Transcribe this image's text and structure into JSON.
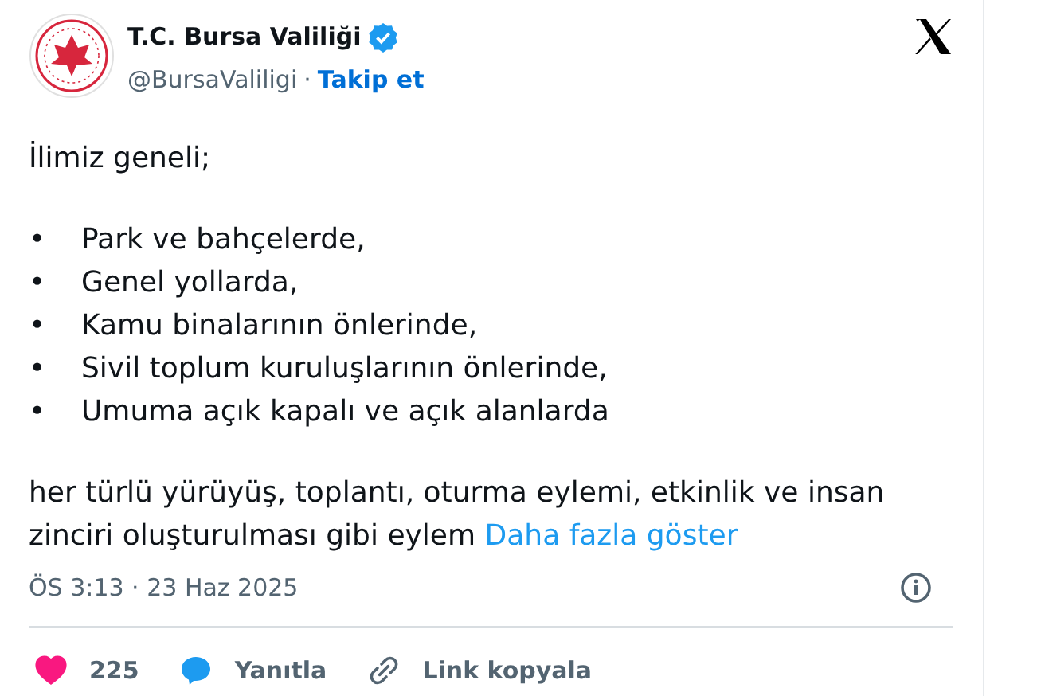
{
  "account": {
    "name": "T.C. Bursa Valiliği",
    "verified": true,
    "handle": "@BursaValiligi",
    "separator": "·",
    "follow": "Takip et"
  },
  "post": {
    "intro": "İlimiz geneli;",
    "bullets": [
      "Park ve bahçelerde,",
      "Genel yollarda,",
      "Kamu binalarının önlerinde,",
      "Sivil toplum kuruluşlarının önlerinde,",
      "Umuma açık kapalı ve açık alanlarda"
    ],
    "bullet_mark": "•",
    "paragraph": "her türlü yürüyüş, toplantı, oturma eylemi, etkinlik ve insan zinciri oluşturulması gibi eylem",
    "more": "Daha fazla göster"
  },
  "timestamp": "ÖS 3:13 · 23 Haz 2025",
  "actions": [
    {
      "kind": "like",
      "label": "225",
      "liked": true
    },
    {
      "kind": "reply",
      "label": "Yanıtla"
    },
    {
      "kind": "copy",
      "label": "Link kopyala"
    }
  ]
}
